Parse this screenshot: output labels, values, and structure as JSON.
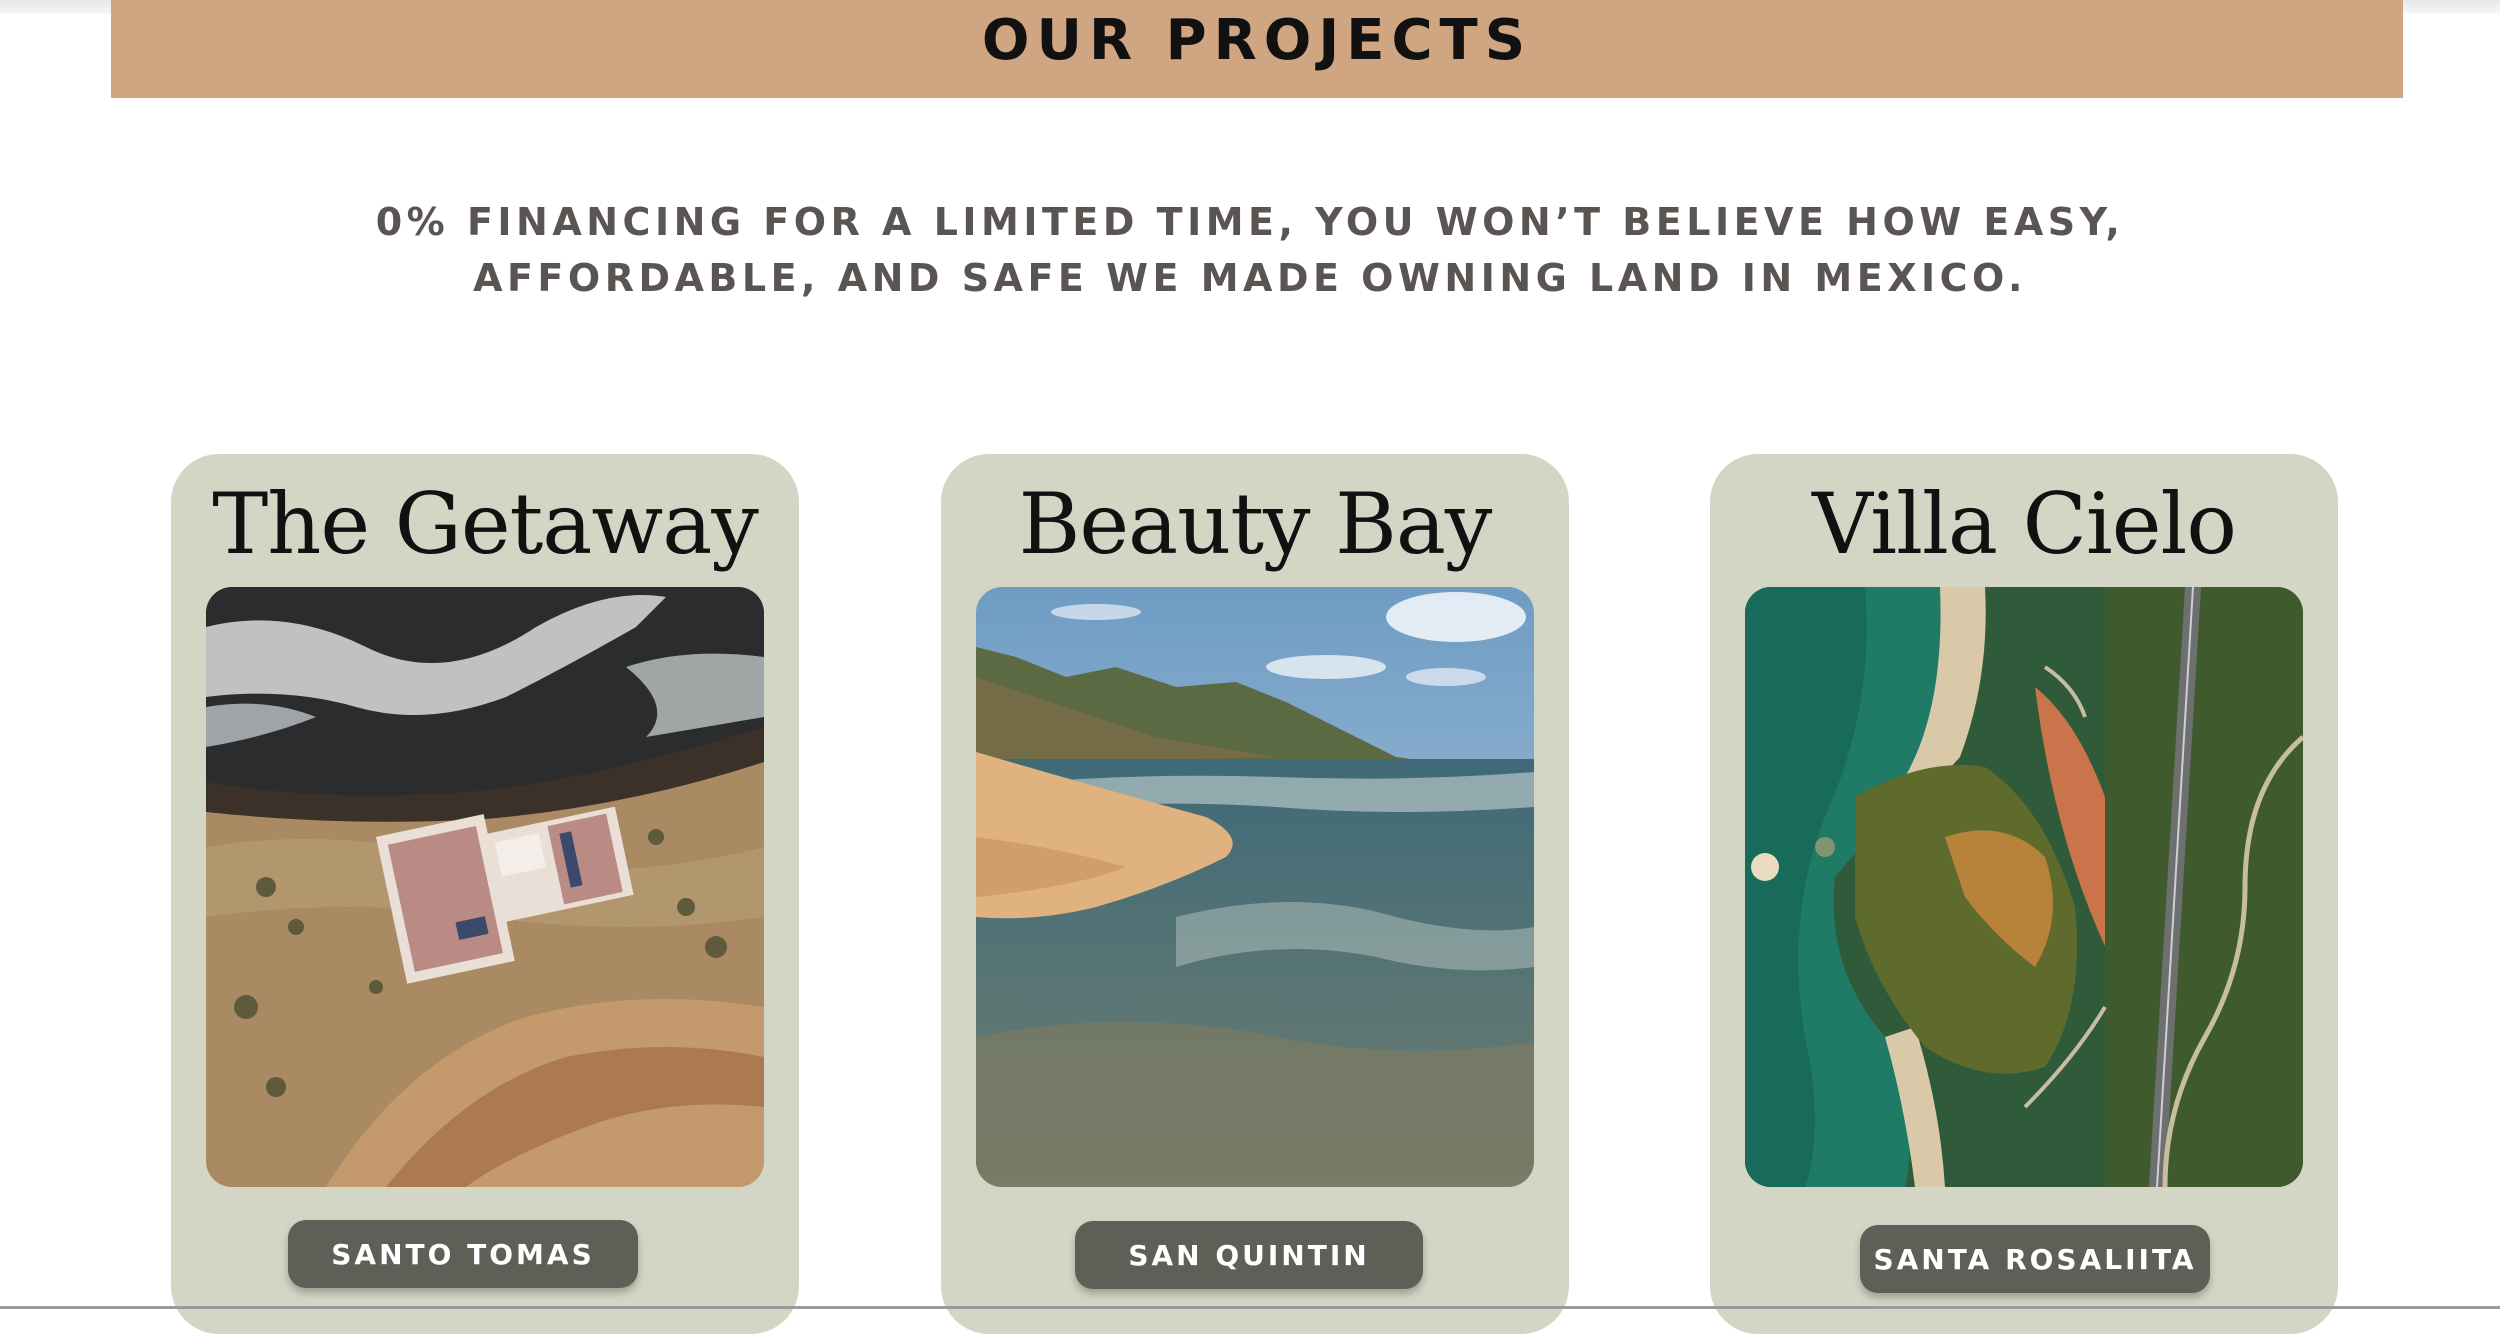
{
  "banner": {
    "title": "OUR PROJECTS"
  },
  "tagline": {
    "line1": "0% FINANCING FOR A LIMITED TIME, YOU WON’T BELIEVE HOW EASY,",
    "line2": "AFFORDABLE, AND SAFE WE MADE OWNING LAND IN MEXICO."
  },
  "projects": [
    {
      "title": "The Getaway",
      "location": "SANTO TOMAS",
      "image": "aerial-coast-house-photo"
    },
    {
      "title": "Beauty Bay",
      "location": "SAN QUINTIN",
      "image": "beach-mountain-photo"
    },
    {
      "title": "Villa Cielo",
      "location": "SANTA ROSALIITA",
      "image": "aerial-coast-road-photo"
    }
  ],
  "colors": {
    "banner": "#cfa582",
    "card": "#d4d6c5",
    "button": "#5c6057",
    "tagline": "#5a5452"
  }
}
